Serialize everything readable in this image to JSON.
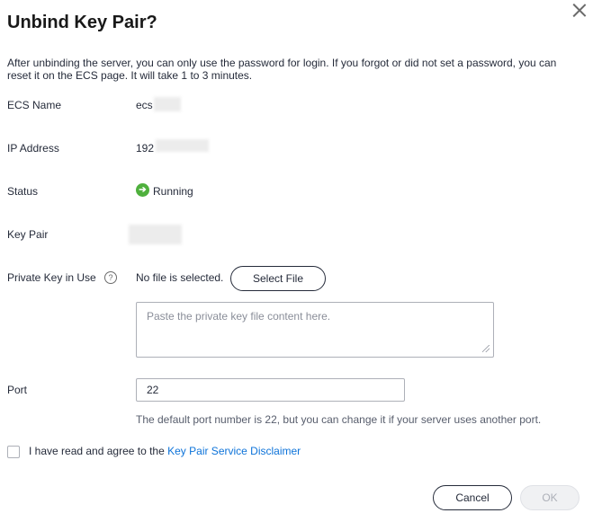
{
  "dialog": {
    "title": "Unbind Key Pair?",
    "description": "After unbinding the server, you can only use the password for login. If you forgot or did not set a password, you can reset it on the ECS page. It will take 1 to 3 minutes."
  },
  "fields": {
    "ecs_name": {
      "label": "ECS Name",
      "value": "ecs"
    },
    "ip_address": {
      "label": "IP Address",
      "value": "192"
    },
    "status": {
      "label": "Status",
      "value": "Running",
      "icon": "arrow-right-circle-icon",
      "color": "#4fb03d"
    },
    "key_pair": {
      "label": "Key Pair",
      "value": ""
    },
    "private_key": {
      "label": "Private Key in Use",
      "file_status": "No file is selected.",
      "select_button": "Select File",
      "placeholder": "Paste the private key file content here.",
      "value": ""
    },
    "port": {
      "label": "Port",
      "value": "22",
      "hint": "The default port number is 22, but you can change it if your server uses another port."
    }
  },
  "agreement": {
    "text": "I have read and agree to the ",
    "link": "Key Pair Service Disclaimer",
    "checked": false
  },
  "footer": {
    "cancel": "Cancel",
    "ok": "OK"
  },
  "colors": {
    "link": "#0d73d9",
    "text": "#252b3a",
    "hint": "#575d6c"
  }
}
